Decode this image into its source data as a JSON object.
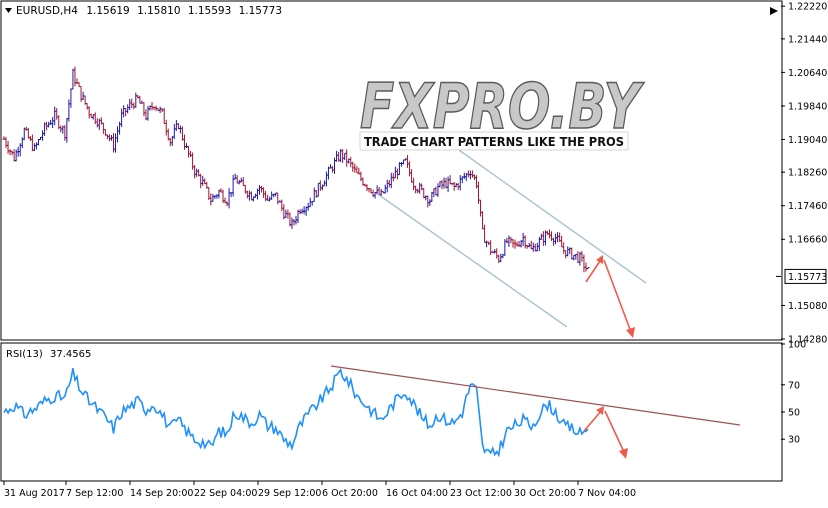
{
  "header": {
    "dropdown_icon": "triangle-down-icon",
    "symbol": "EURUSD,H4",
    "open": "1.15619",
    "high": "1.15810",
    "low": "1.15593",
    "close": "1.15773"
  },
  "watermark": {
    "logo_text": "FXPRO.BY",
    "tagline": "TRADE CHART PATTERNS LIKE THE PROS"
  },
  "rsi_header": {
    "label": "RSI(13)",
    "value": "37.4565"
  },
  "colors": {
    "bull_candle": "#1a1aa8",
    "bear_candle": "#a0142e",
    "rsi_line": "#1e90ff",
    "channel": "#a9c1d0",
    "rsi_trend": "#a05050",
    "forecast_arrow": "#f05a4a",
    "price_label_bg": "#ffffff",
    "axis_text": "#000000"
  },
  "chart_data": [
    {
      "type": "candlestick",
      "symbol": "EURUSD",
      "timeframe": "H4",
      "y_ticks": [
        1.2222,
        1.2144,
        1.2064,
        1.1984,
        1.1904,
        1.1826,
        1.1746,
        1.1666,
        1.1508,
        1.1428
      ],
      "y_tick_labels": [
        "1.22220",
        "1.21440",
        "1.20640",
        "1.19840",
        "1.19040",
        "1.18260",
        "1.17460",
        "1.16660",
        "1.15080",
        "1.14280"
      ],
      "ylim": [
        1.1428,
        1.2232
      ],
      "current_price": 1.15773,
      "current_price_label": "1.15773",
      "x_tick_labels": [
        "31 Aug 2017",
        "7 Sep 12:00",
        "14 Sep 20:00",
        "22 Sep 04:00",
        "29 Sep 12:00",
        "6 Oct 20:00",
        "16 Oct 04:00",
        "23 Oct 12:00",
        "30 Oct 20:00",
        "7 Nov 04:00"
      ],
      "close_path": [
        [
          0,
          1.1905
        ],
        [
          5,
          1.186
        ],
        [
          10,
          1.1925
        ],
        [
          15,
          1.188
        ],
        [
          20,
          1.193
        ],
        [
          25,
          1.196
        ],
        [
          30,
          1.192
        ],
        [
          34,
          1.206
        ],
        [
          38,
          1.201
        ],
        [
          42,
          1.197
        ],
        [
          46,
          1.195
        ],
        [
          50,
          1.1925
        ],
        [
          54,
          1.189
        ],
        [
          58,
          1.196
        ],
        [
          62,
          1.1985
        ],
        [
          66,
          1.2
        ],
        [
          70,
          1.196
        ],
        [
          74,
          1.199
        ],
        [
          78,
          1.1965
        ],
        [
          82,
          1.19
        ],
        [
          86,
          1.194
        ],
        [
          90,
          1.188
        ],
        [
          94,
          1.183
        ],
        [
          98,
          1.18
        ],
        [
          102,
          1.176
        ],
        [
          106,
          1.178
        ],
        [
          110,
          1.176
        ],
        [
          114,
          1.181
        ],
        [
          118,
          1.179
        ],
        [
          122,
          1.177
        ],
        [
          126,
          1.179
        ],
        [
          130,
          1.176
        ],
        [
          134,
          1.177
        ],
        [
          138,
          1.173
        ],
        [
          142,
          1.17
        ],
        [
          146,
          1.174
        ],
        [
          150,
          1.175
        ],
        [
          154,
          1.178
        ],
        [
          158,
          1.181
        ],
        [
          162,
          1.184
        ],
        [
          166,
          1.187
        ],
        [
          170,
          1.185
        ],
        [
          174,
          1.182
        ],
        [
          178,
          1.18
        ],
        [
          182,
          1.178
        ],
        [
          186,
          1.177
        ],
        [
          190,
          1.18
        ],
        [
          194,
          1.183
        ],
        [
          198,
          1.185
        ],
        [
          202,
          1.18
        ],
        [
          206,
          1.178
        ],
        [
          210,
          1.176
        ],
        [
          214,
          1.179
        ],
        [
          218,
          1.18
        ],
        [
          222,
          1.179
        ],
        [
          226,
          1.181
        ],
        [
          230,
          1.183
        ],
        [
          233,
          1.18
        ],
        [
          236,
          1.168
        ],
        [
          240,
          1.164
        ],
        [
          244,
          1.162
        ],
        [
          248,
          1.166
        ],
        [
          252,
          1.165
        ],
        [
          256,
          1.167
        ],
        [
          260,
          1.164
        ],
        [
          264,
          1.166
        ],
        [
          268,
          1.168
        ],
        [
          272,
          1.167
        ],
        [
          276,
          1.164
        ],
        [
          280,
          1.163
        ],
        [
          284,
          1.162
        ],
        [
          288,
          1.159
        ]
      ]
    },
    {
      "type": "line",
      "name": "RSI(13)",
      "y_ticks": [
        100,
        70,
        50,
        30
      ],
      "ylim": [
        0,
        100
      ],
      "current_value": 37.4565,
      "values_path": [
        [
          0,
          50
        ],
        [
          5,
          55
        ],
        [
          10,
          48
        ],
        [
          15,
          52
        ],
        [
          20,
          58
        ],
        [
          25,
          62
        ],
        [
          30,
          60
        ],
        [
          34,
          78
        ],
        [
          38,
          66
        ],
        [
          42,
          58
        ],
        [
          46,
          52
        ],
        [
          50,
          46
        ],
        [
          54,
          38
        ],
        [
          58,
          50
        ],
        [
          62,
          54
        ],
        [
          66,
          58
        ],
        [
          70,
          52
        ],
        [
          74,
          56
        ],
        [
          78,
          48
        ],
        [
          82,
          38
        ],
        [
          86,
          44
        ],
        [
          90,
          36
        ],
        [
          94,
          30
        ],
        [
          98,
          28
        ],
        [
          102,
          24
        ],
        [
          106,
          36
        ],
        [
          110,
          34
        ],
        [
          114,
          50
        ],
        [
          118,
          46
        ],
        [
          122,
          42
        ],
        [
          126,
          48
        ],
        [
          130,
          40
        ],
        [
          134,
          38
        ],
        [
          138,
          30
        ],
        [
          142,
          26
        ],
        [
          146,
          40
        ],
        [
          150,
          48
        ],
        [
          154,
          55
        ],
        [
          158,
          62
        ],
        [
          162,
          70
        ],
        [
          166,
          80
        ],
        [
          170,
          72
        ],
        [
          174,
          62
        ],
        [
          178,
          56
        ],
        [
          182,
          50
        ],
        [
          186,
          44
        ],
        [
          190,
          52
        ],
        [
          194,
          60
        ],
        [
          198,
          66
        ],
        [
          202,
          56
        ],
        [
          206,
          46
        ],
        [
          210,
          40
        ],
        [
          214,
          48
        ],
        [
          218,
          44
        ],
        [
          222,
          42
        ],
        [
          226,
          50
        ],
        [
          230,
          70
        ],
        [
          233,
          66
        ],
        [
          236,
          24
        ],
        [
          240,
          18
        ],
        [
          244,
          22
        ],
        [
          248,
          36
        ],
        [
          252,
          40
        ],
        [
          256,
          44
        ],
        [
          260,
          40
        ],
        [
          264,
          48
        ],
        [
          268,
          56
        ],
        [
          272,
          50
        ],
        [
          276,
          40
        ],
        [
          280,
          38
        ],
        [
          284,
          34
        ],
        [
          288,
          37.4565
        ]
      ]
    }
  ]
}
